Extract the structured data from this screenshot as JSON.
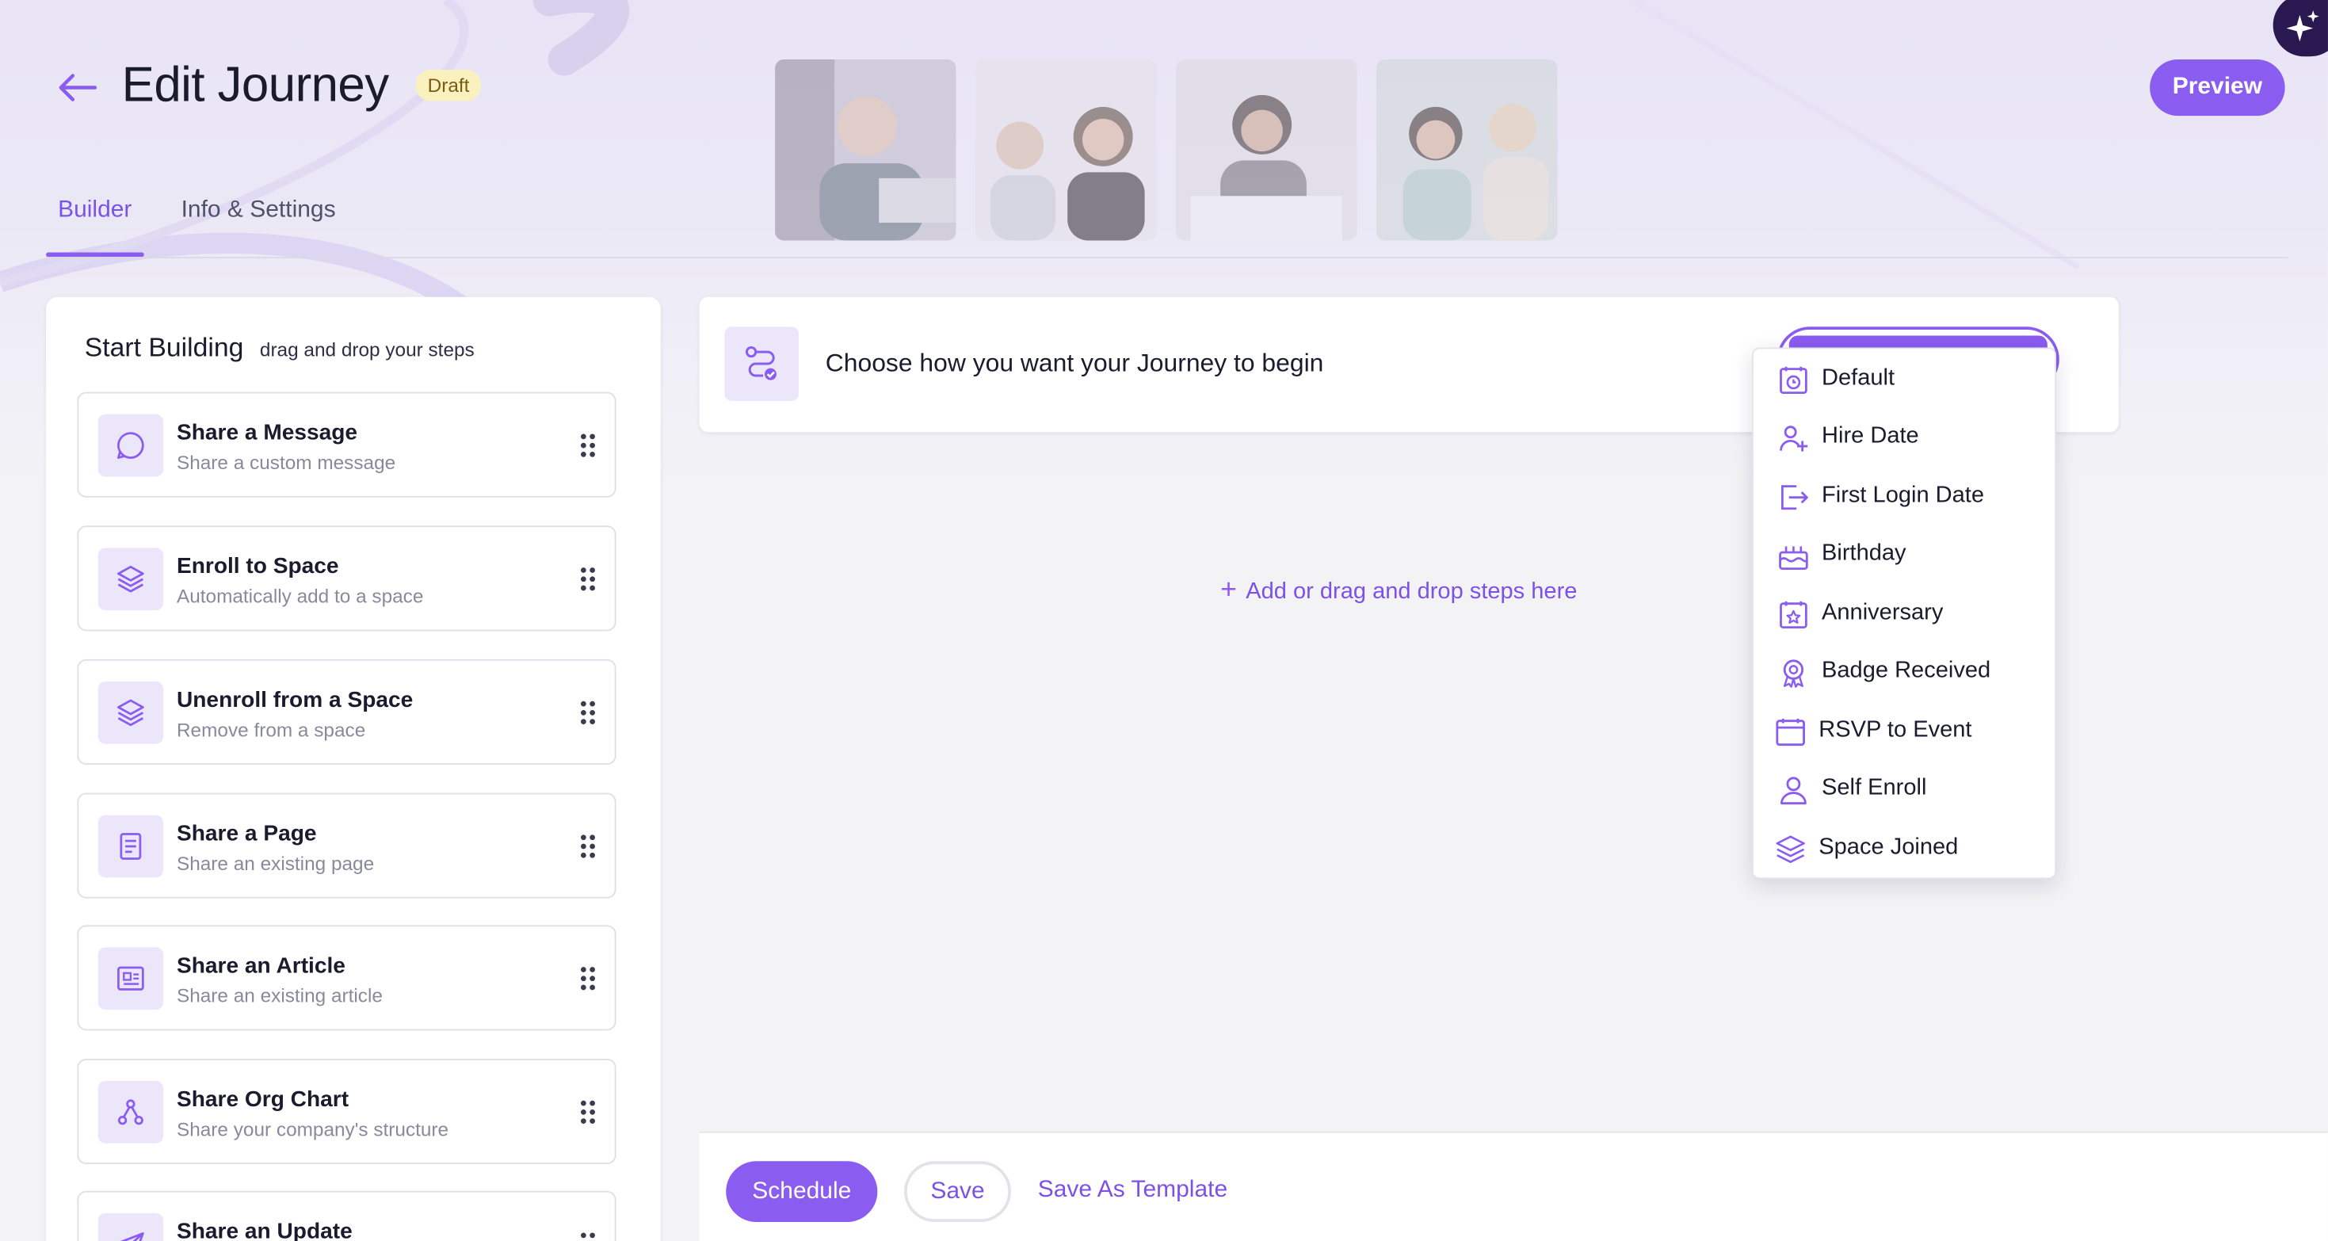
{
  "header": {
    "title": "Edit Journey",
    "status_badge": "Draft",
    "preview_label": "Preview",
    "accent_color": "#8a5cf0",
    "back_icon": "arrow-left-icon"
  },
  "tabs": [
    {
      "label": "Builder",
      "active": true
    },
    {
      "label": "Info & Settings",
      "active": false
    }
  ],
  "left_panel": {
    "title": "Start Building",
    "subtitle": "drag and drop your steps",
    "steps": [
      {
        "title": "Share a Message",
        "description": "Share a custom message",
        "icon": "chat-bubble-icon"
      },
      {
        "title": "Enroll to Space",
        "description": "Automatically add to a space",
        "icon": "layers-icon"
      },
      {
        "title": "Unenroll from a Space",
        "description": "Remove from a space",
        "icon": "layers-icon"
      },
      {
        "title": "Share a Page",
        "description": "Share an existing page",
        "icon": "page-icon"
      },
      {
        "title": "Share an Article",
        "description": "Share an existing article",
        "icon": "article-icon"
      },
      {
        "title": "Share Org Chart",
        "description": "Share your company's structure",
        "icon": "org-chart-icon"
      },
      {
        "title": "Share an Update",
        "description": "",
        "icon": "send-icon"
      }
    ]
  },
  "main": {
    "begin_prompt": "Choose how you want your Journey to begin",
    "add_steps_label": "Add or drag and drop steps here"
  },
  "trigger_dropdown": {
    "options": [
      {
        "label": "Default",
        "icon": "calendar-clock-icon"
      },
      {
        "label": "Hire Date",
        "icon": "user-plus-icon"
      },
      {
        "label": "First Login Date",
        "icon": "login-icon"
      },
      {
        "label": "Birthday",
        "icon": "cake-icon"
      },
      {
        "label": "Anniversary",
        "icon": "calendar-star-icon"
      },
      {
        "label": "Badge Received",
        "icon": "badge-icon"
      },
      {
        "label": "RSVP to Event",
        "icon": "calendar-icon"
      },
      {
        "label": "Self Enroll",
        "icon": "user-icon"
      },
      {
        "label": "Space Joined",
        "icon": "layers-icon"
      }
    ]
  },
  "footer": {
    "schedule_label": "Schedule",
    "save_label": "Save",
    "save_template_label": "Save As Template"
  }
}
